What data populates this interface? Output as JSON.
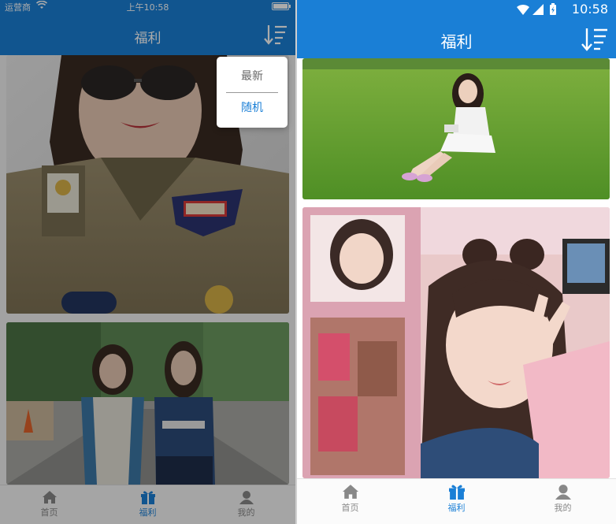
{
  "ios": {
    "status": {
      "carrier": "运营商",
      "time": "上午10:58"
    },
    "nav": {
      "title": "福利"
    },
    "sort_menu": {
      "options": [
        "最新",
        "随机"
      ]
    },
    "tabs": [
      {
        "label": "首页",
        "icon": "home-icon"
      },
      {
        "label": "福利",
        "icon": "gift-icon",
        "active": true
      },
      {
        "label": "我的",
        "icon": "user-icon"
      }
    ]
  },
  "android": {
    "status": {
      "time": "10:58"
    },
    "nav": {
      "title": "福利"
    },
    "tabs": [
      {
        "label": "首页",
        "icon": "home-icon"
      },
      {
        "label": "福利",
        "icon": "gift-icon",
        "active": true
      },
      {
        "label": "我的",
        "icon": "user-icon"
      }
    ]
  },
  "colors": {
    "accent": "#1a7fd6",
    "tab_inactive": "#888888",
    "tab_active": "#1a7fd6"
  },
  "icons": [
    "wifi-icon",
    "battery-icon",
    "sort-icon",
    "signal-icon",
    "home-icon",
    "gift-icon",
    "user-icon"
  ]
}
